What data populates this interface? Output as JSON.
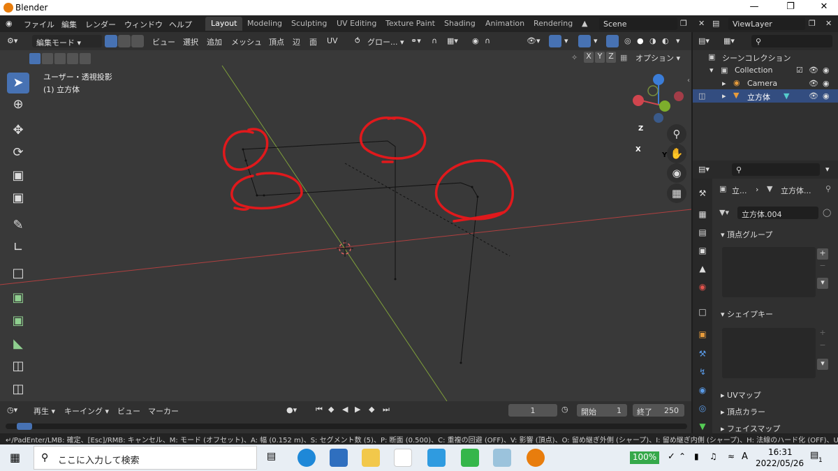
{
  "window": {
    "title": "Blender"
  },
  "topbar": {
    "menus": [
      "ファイル",
      "編集",
      "レンダー",
      "ウィンドウ",
      "ヘルプ"
    ],
    "workspaces": [
      "Layout",
      "Modeling",
      "Sculpting",
      "UV Editing",
      "Texture Paint",
      "Shading",
      "Animation",
      "Rendering"
    ],
    "scene": "Scene",
    "view_layer": "ViewLayer"
  },
  "header3d": {
    "mode": "編集モード",
    "menus": [
      "ビュー",
      "選択",
      "追加",
      "メッシュ",
      "頂点",
      "辺",
      "面",
      "UV"
    ],
    "transform": "グロー...",
    "axes": [
      "X",
      "Y",
      "Z"
    ],
    "options": "オプション"
  },
  "viewport": {
    "view_name": "ユーザー・透視投影",
    "object_name": "(1) 立方体",
    "gizmo_axes": [
      "Z",
      "X",
      "Y"
    ]
  },
  "timeline": {
    "menus": [
      "再生",
      "キーイング",
      "ビュー",
      "マーカー"
    ],
    "current_frame": "1",
    "start_label": "開始",
    "start": "1",
    "end_label": "終了",
    "end": "250"
  },
  "outliner": {
    "root": "シーンコレクション",
    "items": [
      {
        "label": "Collection"
      },
      {
        "label": "Camera"
      },
      {
        "label": "立方体"
      }
    ]
  },
  "properties": {
    "breadcrumb_object": "立...",
    "breadcrumb_mesh": "立方体...",
    "mesh_name": "立方体.004",
    "panels": [
      "頂点グループ",
      "シェイプキー",
      "UVマップ",
      "頂点カラー",
      "フェイスマップ"
    ]
  },
  "statusbar": {
    "text": "↵/PadEnter/LMB: 確定、[Esc]/RMB: キャンセル、M: モード (オフセット)、A: 幅 (0.152 m)、S: セグメント数 (5)、P: 断面 (0.500)、C: 重複の回避 (OFF)、V: 影響 (頂点)、O: 留め継ぎ外側 (シャープ)、I: 留め継ぎ内側 (シャープ)、H: 法線のハード化 (OFF)、U:"
  },
  "taskbar": {
    "search_placeholder": "ここに入力して検索",
    "battery": "100%",
    "ime": "A",
    "time": "16:31",
    "date": "2022/05/26",
    "notifications": "1"
  },
  "colors": {
    "accent": "#4772b3",
    "x_axis": "#c0392b",
    "y_axis": "#8ab53b",
    "annotation": "#e0191c"
  }
}
